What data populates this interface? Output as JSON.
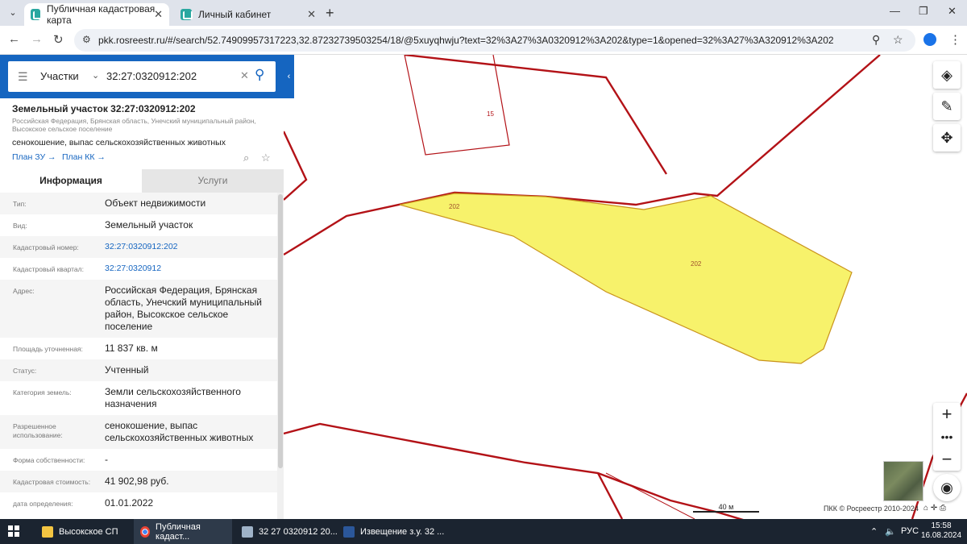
{
  "browser": {
    "tabs": [
      {
        "title": "Публичная кадастровая карта",
        "icon": "rosreestr-favicon",
        "active": true
      },
      {
        "title": "Личный кабинет",
        "icon": "rosreestr-favicon",
        "active": false
      }
    ],
    "url": "pkk.rosreestr.ru/#/search/52.74909957317223,32.87232739503254/18/@5xuyqhwju?text=32%3A27%3A0320912%3A202&type=1&opened=32%3A27%3A320912%3A202"
  },
  "search": {
    "type_label": "Участки",
    "query": "32:27:0320912:202"
  },
  "object": {
    "title": "Земельный участок 32:27:0320912:202",
    "address_short": "Российская Федерация, Брянская область, Унечский муниципальный район, Высокское сельское поселение",
    "use": "сенокошение, выпас сельскохозяйственных животных",
    "plan_zu": "План ЗУ",
    "plan_kk": "План КК"
  },
  "info_tabs": {
    "info": "Информация",
    "services": "Услуги"
  },
  "attributes": [
    {
      "label": "Тип:",
      "value": "Объект недвижимости"
    },
    {
      "label": "Вид:",
      "value": "Земельный участок"
    },
    {
      "label": "Кадастровый номер:",
      "value": "32:27:0320912:202",
      "link": true
    },
    {
      "label": "Кадастровый квартал:",
      "value": "32:27:0320912",
      "link": true
    },
    {
      "label": "Адрес:",
      "value": "Российская Федерация, Брянская область, Унечский муниципальный район, Высокское сельское поселение"
    },
    {
      "label": "Площадь уточненная:",
      "value": "11 837 кв. м"
    },
    {
      "label": "Статус:",
      "value": "Учтенный"
    },
    {
      "label": "Категория земель:",
      "value": "Земли сельскохозяйственного назначения"
    },
    {
      "label": "Разрешенное использование:",
      "value": "сенокошение, выпас сельскохозяйственных животных"
    },
    {
      "label": "Форма собственности:",
      "value": "-"
    },
    {
      "label": "Кадастровая стоимость:",
      "value": "41 902,98 руб."
    },
    {
      "label": "дата определения:",
      "value": "01.01.2022"
    }
  ],
  "map": {
    "parcel_label_a": "202",
    "parcel_label_b": "202",
    "neighbor_label": "15",
    "scale_label": "40 м",
    "copyright": "ПКК © Росреестр 2010-2024",
    "parcel_fill": "#f7f26b",
    "boundary_color": "#b31217"
  },
  "taskbar": {
    "items": [
      {
        "label": "Высокское СП",
        "icon": "folder-icon"
      },
      {
        "label": "Публичная кадаст...",
        "icon": "chrome-icon"
      },
      {
        "label": "32 27 0320912 20...",
        "icon": "image-viewer-icon"
      },
      {
        "label": "Извещение з.у. 32 ...",
        "icon": "word-icon"
      }
    ],
    "lang": "РУС",
    "time": "15:58",
    "date": "16.08.2024"
  }
}
